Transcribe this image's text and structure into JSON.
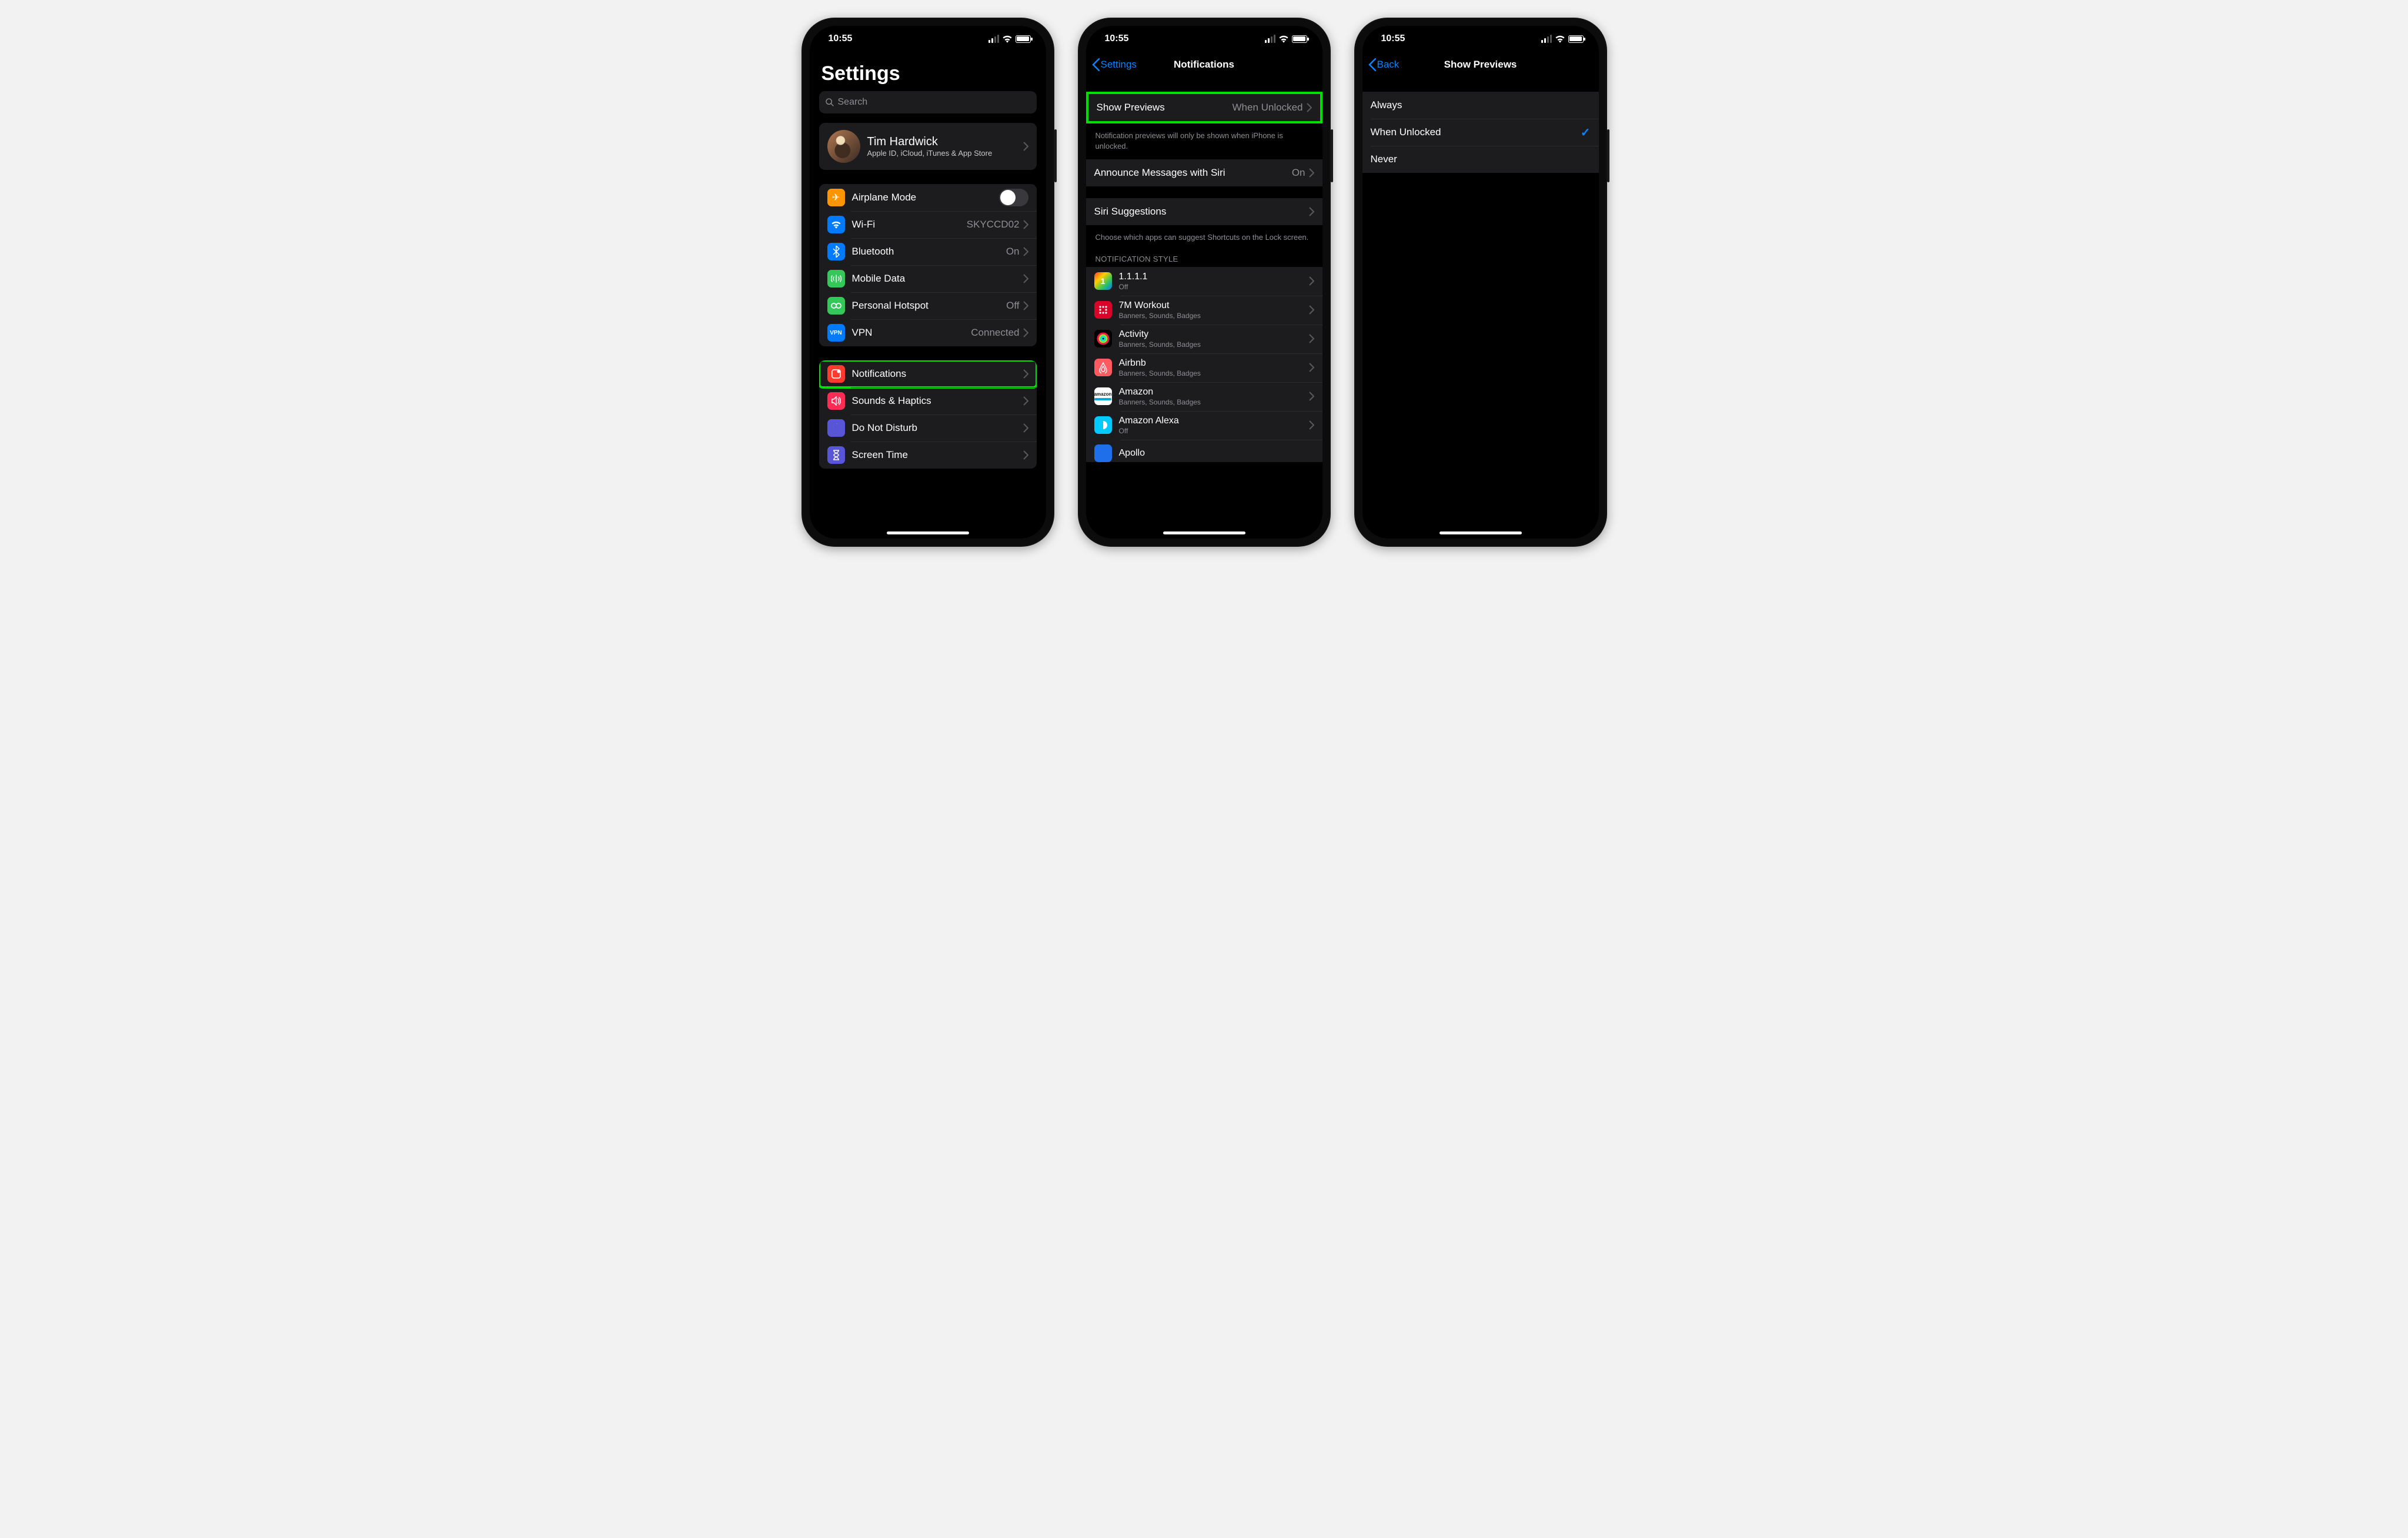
{
  "status": {
    "time": "10:55"
  },
  "screen1": {
    "title": "Settings",
    "search_placeholder": "Search",
    "profile": {
      "name": "Tim Hardwick",
      "sub": "Apple ID, iCloud, iTunes & App Store"
    },
    "group1": [
      {
        "id": "airplane",
        "label": "Airplane Mode",
        "type": "toggle",
        "color": "#ff9500"
      },
      {
        "id": "wifi",
        "label": "Wi-Fi",
        "value": "SKYCCD02",
        "color": "#007aff"
      },
      {
        "id": "bt",
        "label": "Bluetooth",
        "value": "On",
        "color": "#007aff"
      },
      {
        "id": "mobile",
        "label": "Mobile Data",
        "value": "",
        "color": "#34c759"
      },
      {
        "id": "hotspot",
        "label": "Personal Hotspot",
        "value": "Off",
        "color": "#34c759"
      },
      {
        "id": "vpn",
        "label": "VPN",
        "value": "Connected",
        "color": "#007aff",
        "badge": "VPN"
      }
    ],
    "group2": [
      {
        "id": "notifications",
        "label": "Notifications",
        "color": "#ff3b30",
        "highlight": true
      },
      {
        "id": "sounds",
        "label": "Sounds & Haptics",
        "color": "#ff2d55"
      },
      {
        "id": "dnd",
        "label": "Do Not Disturb",
        "color": "#5856d6"
      },
      {
        "id": "screentime",
        "label": "Screen Time",
        "color": "#5856d6"
      }
    ]
  },
  "screen2": {
    "back": "Settings",
    "title": "Notifications",
    "previews": {
      "label": "Show Previews",
      "value": "When Unlocked"
    },
    "previews_footer": "Notification previews will only be shown when iPhone is unlocked.",
    "announce": {
      "label": "Announce Messages with Siri",
      "value": "On"
    },
    "siri": {
      "label": "Siri Suggestions"
    },
    "siri_footer": "Choose which apps can suggest Shortcuts on the Lock screen.",
    "style_header": "NOTIFICATION STYLE",
    "apps": [
      {
        "name": "1.1.1.1",
        "sub": "Off",
        "bg": "linear-gradient(135deg,#ff2d55,#ffcc00,#34c759,#007aff)"
      },
      {
        "name": "7M Workout",
        "sub": "Banners, Sounds, Badges",
        "bg": "#d90429"
      },
      {
        "name": "Activity",
        "sub": "Banners, Sounds, Badges",
        "bg": "#000"
      },
      {
        "name": "Airbnb",
        "sub": "Banners, Sounds, Badges",
        "bg": "#ff5a5f"
      },
      {
        "name": "Amazon",
        "sub": "Banners, Sounds, Badges",
        "bg": "#fff"
      },
      {
        "name": "Amazon Alexa",
        "sub": "Off",
        "bg": "#00caff"
      },
      {
        "name": "Apollo",
        "sub": "",
        "bg": "#1f6feb"
      }
    ]
  },
  "screen3": {
    "back": "Back",
    "title": "Show Previews",
    "options": [
      {
        "label": "Always",
        "selected": false
      },
      {
        "label": "When Unlocked",
        "selected": true
      },
      {
        "label": "Never",
        "selected": false
      }
    ]
  }
}
